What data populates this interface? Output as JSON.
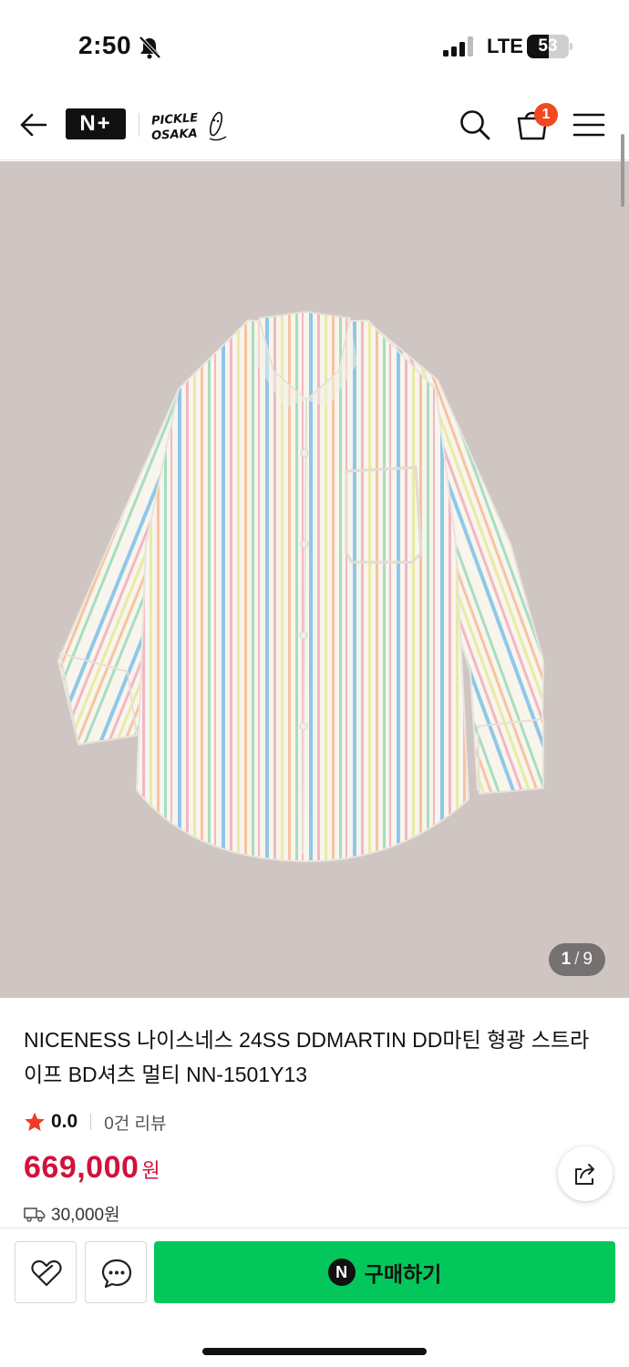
{
  "status_bar": {
    "time": "2:50",
    "network": "LTE",
    "battery": "53",
    "battery_level": 0.53
  },
  "header": {
    "logo_text": "N+",
    "brand_logo_text": [
      "PICKLE",
      "OSAKA"
    ],
    "cart_badge": "1",
    "icons": [
      "back-arrow-icon",
      "search-icon",
      "shopping-bag-icon",
      "hamburger-menu-icon"
    ]
  },
  "gallery": {
    "current": "1",
    "separator": "/",
    "total": "9"
  },
  "product": {
    "title": "NICENESS 나이스네스 24SS DDMARTIN DD마틴 형광 스트라이프 BD셔츠 멀티 NN-1501Y13",
    "rating": "0.0",
    "review_count": "0건 리뷰",
    "price": "669,000",
    "currency": "원",
    "shipping": "30,000원"
  },
  "bottom_bar": {
    "buy_label": "구매하기",
    "npay_mark": "N"
  },
  "colors": {
    "price": "#d1123b",
    "buy": "#03c75a",
    "badge": "#f24822",
    "star": "#f03a28",
    "image_bg": "#cfc6c3"
  }
}
